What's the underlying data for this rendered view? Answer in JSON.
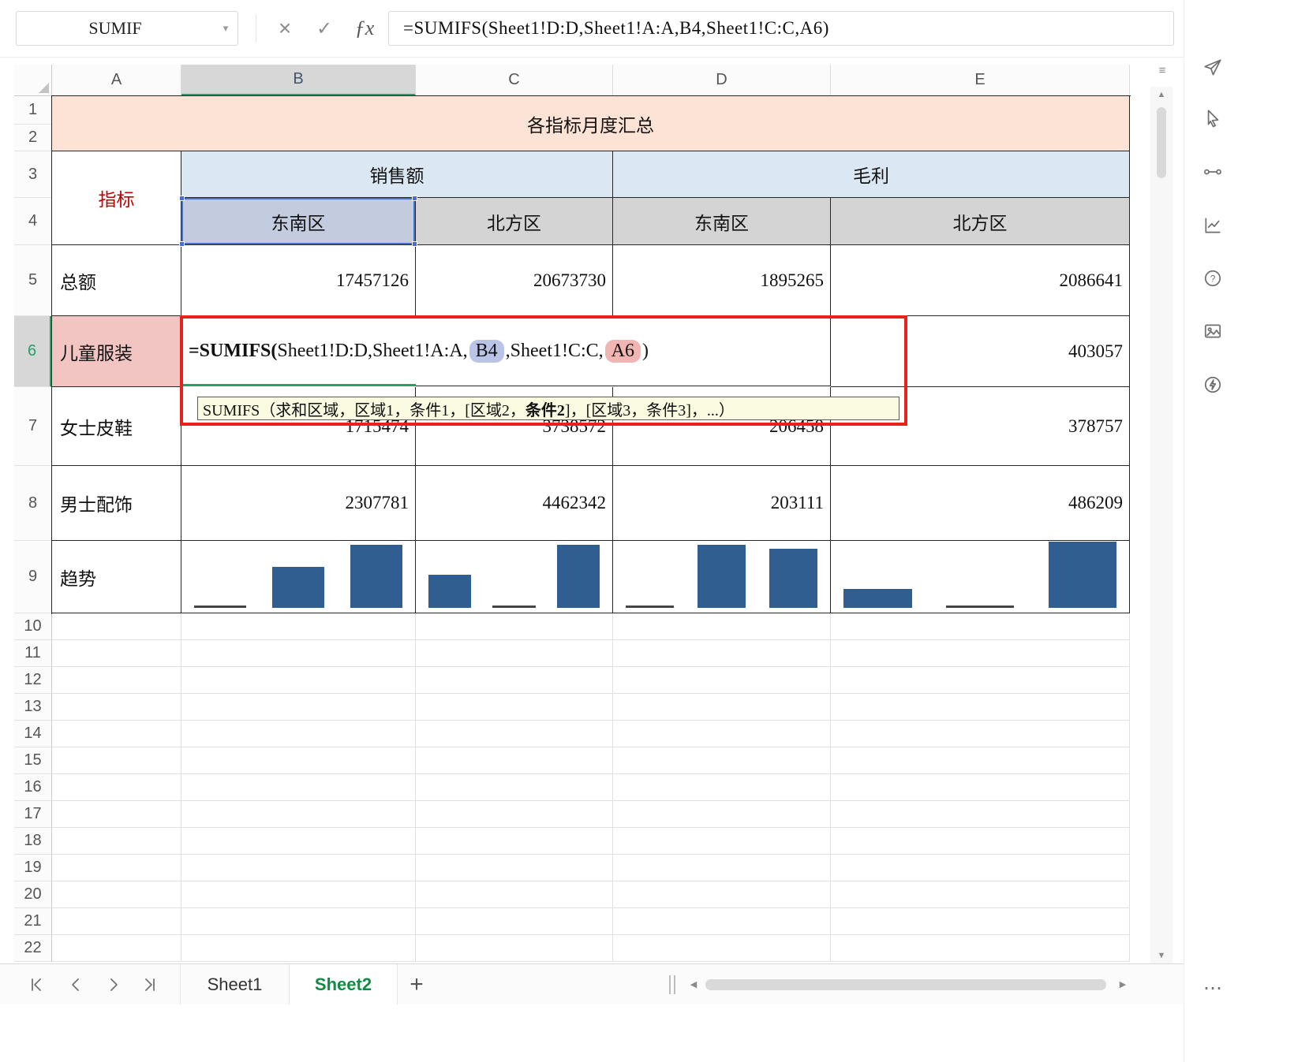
{
  "formula_bar": {
    "name_box_value": "SUMIF",
    "cancel_label": "×",
    "confirm_label": "✓",
    "fx_label": "ƒx",
    "formula_text": "=SUMIFS(Sheet1!D:D,Sheet1!A:A,B4,Sheet1!C:C,A6)"
  },
  "grid": {
    "columns": [
      "A",
      "B",
      "C",
      "D",
      "E"
    ],
    "rows": [
      "1",
      "2",
      "3",
      "4",
      "5",
      "6",
      "7",
      "8",
      "9",
      "10",
      "11",
      "12",
      "13",
      "14",
      "15",
      "16",
      "17",
      "18",
      "19",
      "20",
      "21",
      "22"
    ],
    "selected_column": "B",
    "selected_row": "6"
  },
  "sheet": {
    "title": "各指标月度汇总",
    "indicator_header": "指标",
    "group_headers": [
      "销售额",
      "毛利"
    ],
    "region_headers": [
      "东南区",
      "北方区",
      "东南区",
      "北方区"
    ],
    "rows": [
      {
        "label": "总额",
        "values": [
          "17457126",
          "20673730",
          "1895265",
          "2086641"
        ]
      },
      {
        "label": "儿童服装",
        "values": [
          "",
          "",
          "",
          "403057"
        ]
      },
      {
        "label": "女士皮鞋",
        "values": [
          "1715474",
          "3738572",
          "206458",
          "378757"
        ]
      },
      {
        "label": "男士配饰",
        "values": [
          "2307781",
          "4462342",
          "203111",
          "486209"
        ]
      },
      {
        "label": "趋势",
        "values": [
          "",
          "",
          "",
          ""
        ]
      }
    ]
  },
  "editing": {
    "cell": "B6",
    "segments": [
      {
        "text": "=SUMIFS(",
        "style": "bold"
      },
      {
        "text": "Sheet1!D:D,Sheet1!A:A,",
        "style": "plain"
      },
      {
        "text": "B4",
        "style": "ref-blue"
      },
      {
        "text": ",Sheet1!C:C,",
        "style": "plain"
      },
      {
        "text": "A6",
        "style": "ref-pink"
      },
      {
        "text": ")",
        "style": "plain"
      }
    ],
    "tooltip": {
      "prefix": "SUMIFS（求和区域，区域1，条件1，[区域2，",
      "bold": "条件2",
      "suffix": "]，[区域3，条件3]，...）"
    }
  },
  "sparklines": {
    "type": "bar",
    "B": [
      2,
      62,
      95
    ],
    "C": [
      50,
      2,
      95
    ],
    "D": [
      2,
      95,
      89
    ],
    "E": [
      28,
      2,
      100
    ]
  },
  "tab_bar": {
    "tabs": [
      {
        "label": "Sheet1",
        "active": false
      },
      {
        "label": "Sheet2",
        "active": true
      }
    ],
    "add_tab_label": "+"
  },
  "icons": {
    "caret_down": "▾",
    "up_arrow": "▲",
    "down_arrow": "▼",
    "left_arrow": "◀",
    "right_arrow": "▶",
    "more": "⋯",
    "formula_bar_toggle": "≡"
  },
  "sidebar": {
    "icons": [
      "share",
      "select-cursor",
      "connector",
      "chart",
      "help",
      "smart-image",
      "energy",
      "more"
    ]
  },
  "colors": {
    "accent_green": "#21a366",
    "tab_active_green": "#0e8c43",
    "selection_blue": "#4a6ed0",
    "ref_pill_blue": "#b9c4e6",
    "ref_pill_pink": "#f1b6b2",
    "title_bg": "#fce3d5",
    "group_header_bg": "#dbe7f3",
    "region_header_bg": "#d4d4d4",
    "selected_region_bg": "#c3cbde",
    "indicator_text_red": "#c00000",
    "cell_a6_bg": "#f3c5c2",
    "annotation_red": "#e8221a",
    "sparkline_bar": "#305e90",
    "tooltip_bg": "#fbfbe2"
  }
}
